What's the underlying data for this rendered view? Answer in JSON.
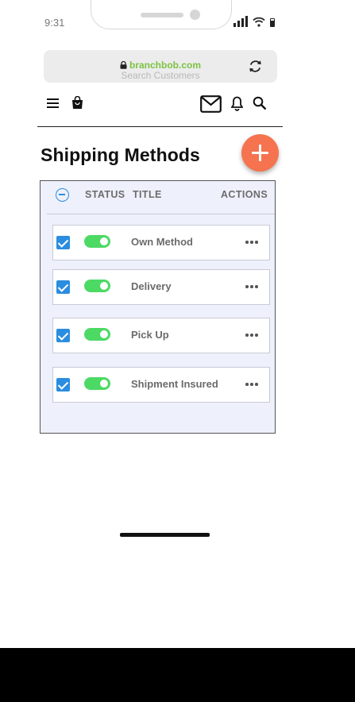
{
  "status_bar": {
    "time": "9:31"
  },
  "browser": {
    "domain": "branchbob.com",
    "search_placeholder": "Search Customers"
  },
  "page": {
    "title": "Shipping Methods"
  },
  "table": {
    "headers": {
      "status": "STATUS",
      "title": "TITLE",
      "actions": "ACTIONS"
    },
    "rows": [
      {
        "name": "Own Method",
        "checked": true,
        "enabled": true
      },
      {
        "name": "Delivery",
        "checked": true,
        "enabled": true
      },
      {
        "name": "Pick Up",
        "checked": true,
        "enabled": true
      },
      {
        "name": "Shipment Insured",
        "checked": true,
        "enabled": true
      }
    ]
  },
  "colors": {
    "accent": "#2b8de0",
    "fab": "#f5734f",
    "toggle_on": "#4cd964",
    "domain_text": "#7dc242",
    "table_bg": "#eef0fb"
  },
  "icons": [
    "menu-icon",
    "shopping-bag-icon",
    "mail-icon",
    "bell-icon",
    "search-icon",
    "reload-icon",
    "lock-icon",
    "add-icon",
    "minus-circle-icon",
    "more-icon"
  ]
}
